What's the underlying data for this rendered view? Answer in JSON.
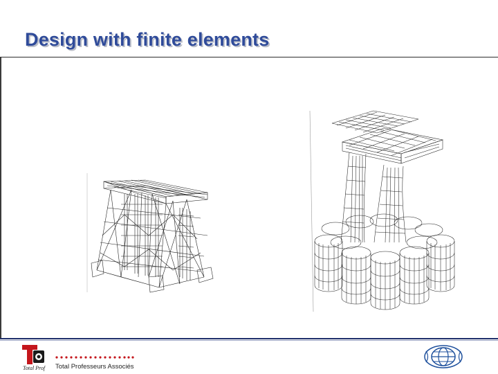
{
  "slide": {
    "title": "Design with finite elements"
  },
  "figures": {
    "left": {
      "icon": "jacket-frame-mesh-icon"
    },
    "right": {
      "icon": "gravity-platform-mesh-icon"
    }
  },
  "footer": {
    "logo_caption": "Total Prof",
    "company": "Total Professeurs Associés",
    "logo_icon": "total-prof-logo-icon",
    "emblem_icon": "globe-emblem-icon"
  },
  "colors": {
    "title": "#2f4b9a",
    "rule": "#1f2f6b",
    "logo_red": "#c4161c",
    "dots_red": "#c4161c",
    "emblem_blue": "#1d4f9c"
  }
}
